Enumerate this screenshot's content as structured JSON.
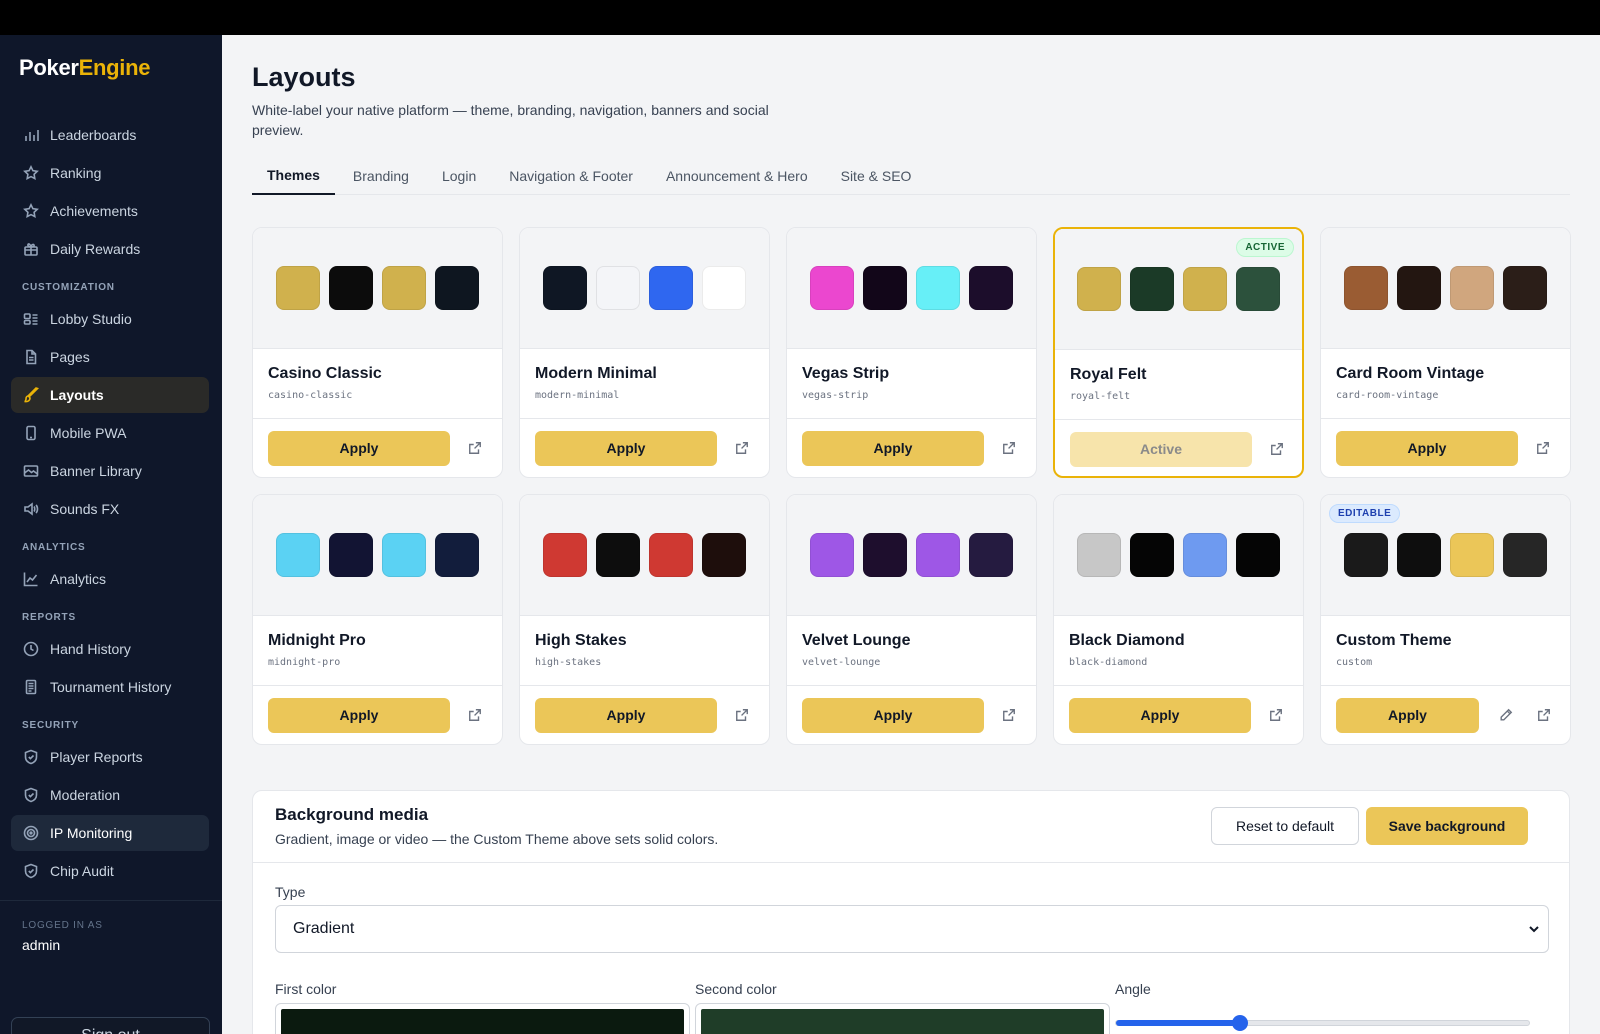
{
  "brand": {
    "part1": "Poker",
    "part2": "Engine"
  },
  "sidebar": {
    "groups": [
      {
        "section": "",
        "items": [
          {
            "label": "Leaderboards",
            "icon": "bar-chart-icon"
          },
          {
            "label": "Ranking",
            "icon": "star-icon"
          },
          {
            "label": "Achievements",
            "icon": "star-icon"
          },
          {
            "label": "Daily Rewards",
            "icon": "gift-icon"
          }
        ]
      },
      {
        "section": "CUSTOMIZATION",
        "items": [
          {
            "label": "Lobby Studio",
            "icon": "layout-icon"
          },
          {
            "label": "Pages",
            "icon": "file-icon"
          },
          {
            "label": "Layouts",
            "icon": "brush-icon",
            "active": true
          },
          {
            "label": "Mobile PWA",
            "icon": "phone-icon"
          },
          {
            "label": "Banner Library",
            "icon": "image-icon"
          },
          {
            "label": "Sounds FX",
            "icon": "speaker-icon"
          }
        ]
      },
      {
        "section": "ANALYTICS",
        "items": [
          {
            "label": "Analytics",
            "icon": "line-chart-icon"
          }
        ]
      },
      {
        "section": "REPORTS",
        "items": [
          {
            "label": "Hand History",
            "icon": "clock-icon"
          },
          {
            "label": "Tournament History",
            "icon": "trophy-icon"
          }
        ]
      },
      {
        "section": "SECURITY",
        "items": [
          {
            "label": "Player Reports",
            "icon": "shield-icon"
          },
          {
            "label": "Moderation",
            "icon": "shield-icon"
          },
          {
            "label": "IP Monitoring",
            "icon": "radar-icon",
            "hover": true
          },
          {
            "label": "Chip Audit",
            "icon": "shield-icon"
          }
        ]
      }
    ],
    "logged_in_label": "LOGGED IN AS",
    "user": "admin",
    "signout": "Sign out"
  },
  "page": {
    "title": "Layouts",
    "subtitle": "White-label your native platform — theme, branding, navigation, banners and social preview."
  },
  "tabs": [
    "Themes",
    "Branding",
    "Login",
    "Navigation & Footer",
    "Announcement & Hero",
    "Site & SEO"
  ],
  "themes": [
    {
      "name": "Casino Classic",
      "slug": "casino-classic",
      "colors": [
        "#d0b14d",
        "#0c0c0c",
        "#d0b14d",
        "#0e1620"
      ],
      "button": "Apply"
    },
    {
      "name": "Modern Minimal",
      "slug": "modern-minimal",
      "colors": [
        "#0f1724",
        "#f4f5f8",
        "#2f67f0",
        "#ffffff"
      ],
      "button": "Apply"
    },
    {
      "name": "Vegas Strip",
      "slug": "vegas-strip",
      "colors": [
        "#eb47cf",
        "#120619",
        "#67eff7",
        "#1c0d2b"
      ],
      "button": "Apply"
    },
    {
      "name": "Royal Felt",
      "slug": "royal-felt",
      "colors": [
        "#d0b14d",
        "#1b3a27",
        "#d0b14d",
        "#2c513c"
      ],
      "button": "Active",
      "active": true,
      "badge": "ACTIVE"
    },
    {
      "name": "Card Room Vintage",
      "slug": "card-room-vintage",
      "colors": [
        "#9a5c33",
        "#231611",
        "#d0a67e",
        "#2b1e18"
      ],
      "button": "Apply"
    },
    {
      "name": "Midnight Pro",
      "slug": "midnight-pro",
      "colors": [
        "#5bd2f3",
        "#121433",
        "#5bd2f3",
        "#121d3c"
      ],
      "button": "Apply"
    },
    {
      "name": "High Stakes",
      "slug": "high-stakes",
      "colors": [
        "#cf3932",
        "#0d0d0d",
        "#cf3932",
        "#1e0e0c"
      ],
      "button": "Apply"
    },
    {
      "name": "Velvet Lounge",
      "slug": "velvet-lounge",
      "colors": [
        "#9e57e6",
        "#1e0e2d",
        "#9e57e6",
        "#251b40"
      ],
      "button": "Apply"
    },
    {
      "name": "Black Diamond",
      "slug": "black-diamond",
      "colors": [
        "#c7c7c7",
        "#050505",
        "#6e9af0",
        "#050505"
      ],
      "button": "Apply"
    },
    {
      "name": "Custom Theme",
      "slug": "custom",
      "colors": [
        "#1a1a1a",
        "#0e0e0e",
        "#ebc658",
        "#262626"
      ],
      "button": "Apply",
      "badge": "EDITABLE",
      "editable": true
    }
  ],
  "background_media": {
    "title": "Background media",
    "subtitle": "Gradient, image or video — the Custom Theme above sets solid colors.",
    "reset_label": "Reset to default",
    "save_label": "Save background",
    "type_label": "Type",
    "type_value": "Gradient",
    "first_color_label": "First color",
    "first_color": "#0b1a0f",
    "second_color_label": "Second color",
    "second_color": "#1f3d28",
    "angle_label": "Angle",
    "angle_fraction": 0.3
  },
  "colors": {
    "accent": "#ebc658",
    "sidebar_bg": "#0f172a",
    "active_border": "#eab308"
  }
}
